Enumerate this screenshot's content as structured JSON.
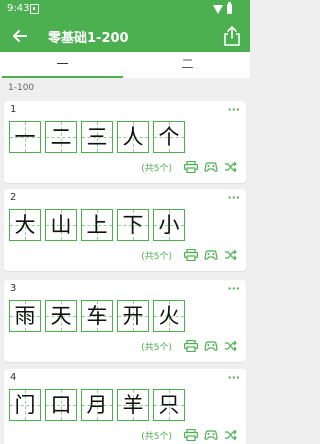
{
  "status": {
    "time": "9:43"
  },
  "header": {
    "title": "零基础1-200"
  },
  "tabs": [
    {
      "label": "一"
    },
    {
      "label": "二"
    }
  ],
  "section": {
    "label": "1-100"
  },
  "cards": [
    {
      "index": "1",
      "chars": [
        "一",
        "二",
        "三",
        "人",
        "个"
      ],
      "count": "(共5个)"
    },
    {
      "index": "2",
      "chars": [
        "大",
        "山",
        "上",
        "下",
        "小"
      ],
      "count": "(共5个)"
    },
    {
      "index": "3",
      "chars": [
        "雨",
        "天",
        "车",
        "开",
        "火"
      ],
      "count": "(共5个)"
    },
    {
      "index": "4",
      "chars": [
        "门",
        "口",
        "月",
        "羊",
        "只"
      ],
      "count": "(共5个)"
    }
  ],
  "icons": {
    "more": "more-dots",
    "print": "printer",
    "game": "gamepad",
    "shuffle": "shuffle"
  },
  "colors": {
    "accent": "#4caf50"
  }
}
